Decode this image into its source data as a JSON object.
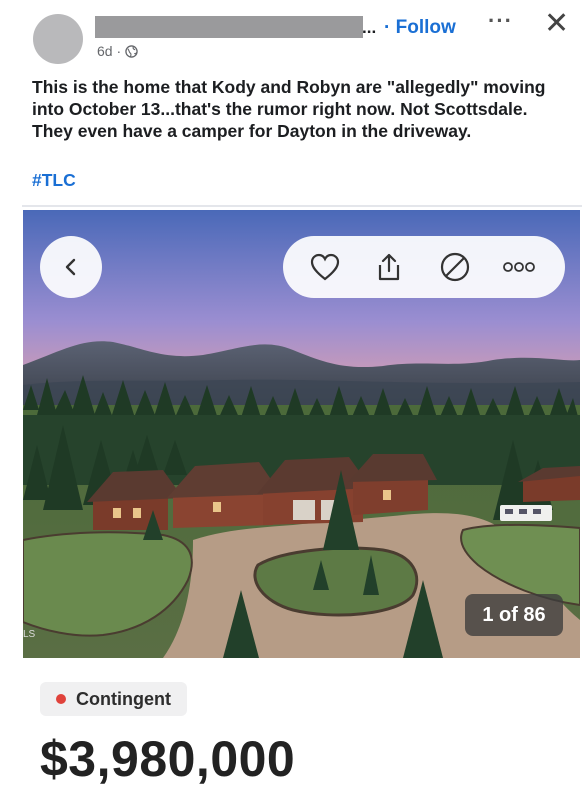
{
  "post": {
    "name_suffix": "...",
    "follow_label": "· Follow",
    "more_icon": "more-dots-icon",
    "close_icon": "close-icon",
    "time": "6d ·",
    "privacy_icon": "globe-icon",
    "text": "This is the home that Kody and Robyn are \"allegedly\" moving into October 13...that's the rumor right now. Not Scottsdale. They even have a camper for Dayton in the driveway.",
    "hashtag": "#TLC"
  },
  "listing": {
    "actions": [
      "back-arrow-icon",
      "heart-icon",
      "share-icon",
      "hide-icon",
      "more-icon"
    ],
    "photo_counter": "1 of 86",
    "mls_tag": "LS",
    "status_label": "Contingent",
    "status_color": "#e0423b",
    "price": "$3,980,000"
  },
  "colors": {
    "link": "#1a6fd4",
    "text": "#1c1e21"
  }
}
